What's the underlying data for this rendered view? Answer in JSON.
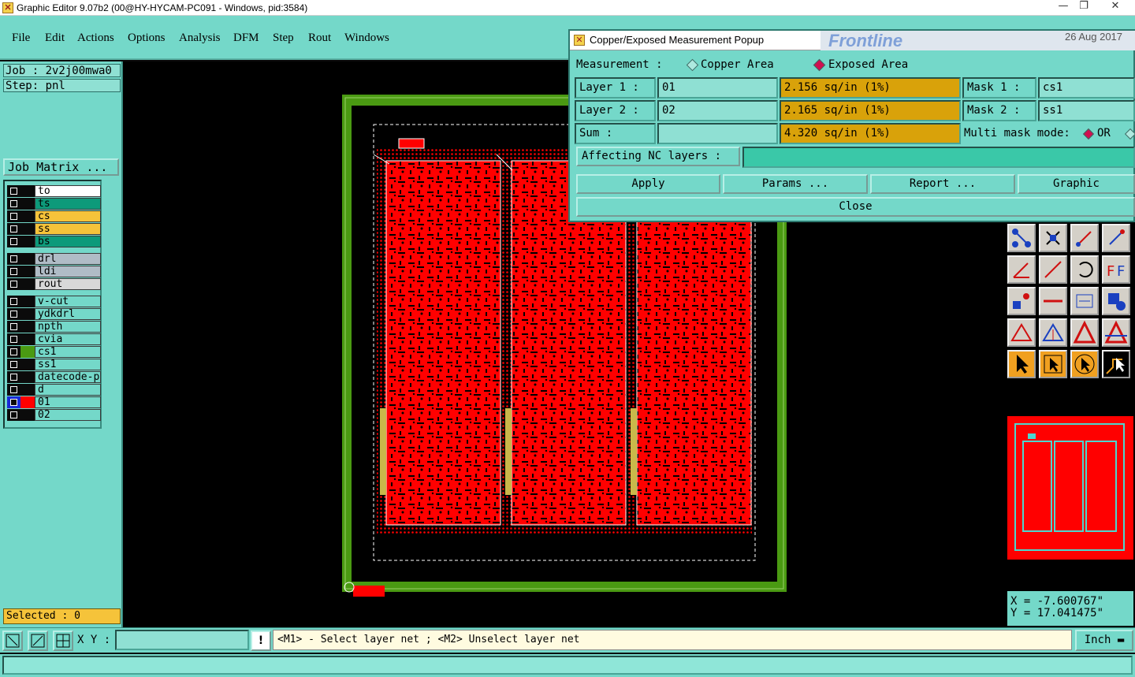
{
  "window": {
    "title": "Graphic Editor 9.07b2 (00@HY-HYCAM-PC091 - Windows, pid:3584)"
  },
  "menu": [
    "File",
    "Edit",
    "Actions",
    "Options",
    "Analysis",
    "DFM",
    "Step",
    "Rout",
    "Windows"
  ],
  "job": {
    "job_label": "Job : 2v2j00mwa0",
    "step_label": "Step: pnl",
    "matrix_button": "Job Matrix ..."
  },
  "layers": [
    {
      "name": "to",
      "color": "#ffffff"
    },
    {
      "name": "ts",
      "color": "#0d9a7a"
    },
    {
      "name": "cs",
      "color": "#f5c33a"
    },
    {
      "name": "ss",
      "color": "#f5c33a"
    },
    {
      "name": "bs",
      "color": "#0d9a7a"
    },
    {
      "name": "drl",
      "color": "#b0bcc6"
    },
    {
      "name": "ldi",
      "color": "#b0bcc6"
    },
    {
      "name": "rout",
      "color": "#d8d8d8"
    },
    {
      "name": "v-cut",
      "color": "#74d8c9"
    },
    {
      "name": "ydkdrl",
      "color": "#74d8c9"
    },
    {
      "name": "npth",
      "color": "#74d8c9"
    },
    {
      "name": "cvia",
      "color": "#74d8c9"
    },
    {
      "name": "cs1",
      "color": "#74d8c9"
    },
    {
      "name": "ss1",
      "color": "#74d8c9"
    },
    {
      "name": "datecode-pt",
      "color": "#74d8c9"
    },
    {
      "name": "d",
      "color": "#74d8c9"
    },
    {
      "name": "01",
      "color": "#74d8c9"
    },
    {
      "name": "02",
      "color": "#74d8c9"
    }
  ],
  "selected": "Selected : 0",
  "popup": {
    "title": "Copper/Exposed Measurement Popup",
    "measurement_label": "Measurement  :",
    "opt_copper": "Copper Area",
    "opt_exposed": "Exposed Area",
    "layer1_label": "Layer 1 :",
    "layer1_value": "01",
    "layer1_result": "2.156 sq/in (1%)",
    "mask1_label": "Mask 1 :",
    "mask1_value": "cs1",
    "layer2_label": "Layer 2 :",
    "layer2_value": "02",
    "layer2_result": "2.165 sq/in (1%)",
    "mask2_label": "Mask 2 :",
    "mask2_value": "ss1",
    "sum_label": "Sum      :",
    "sum_result": "4.320 sq/in (1%)",
    "multi_label": "Multi mask mode:",
    "multi_or": "OR",
    "nc_label": "Affecting NC layers :",
    "btn_apply": "Apply",
    "btn_params": "Params ...",
    "btn_report": "Report ...",
    "btn_graphic": "Graphic",
    "btn_close": "Close"
  },
  "banner": {
    "brand": "Frontline",
    "date": "26 Aug 2017"
  },
  "coords": {
    "x": "X = -7.600767\"",
    "y": "Y = 17.041475\""
  },
  "status": {
    "xy_label": "X Y :",
    "message": "<M1> - Select layer net ; <M2> Unselect layer net",
    "unit": "Inch"
  },
  "colors": {
    "panel": "#74d8c9",
    "copper": "#ff0000",
    "frame": "#4a9a12",
    "result_bg": "#d9a20a"
  }
}
